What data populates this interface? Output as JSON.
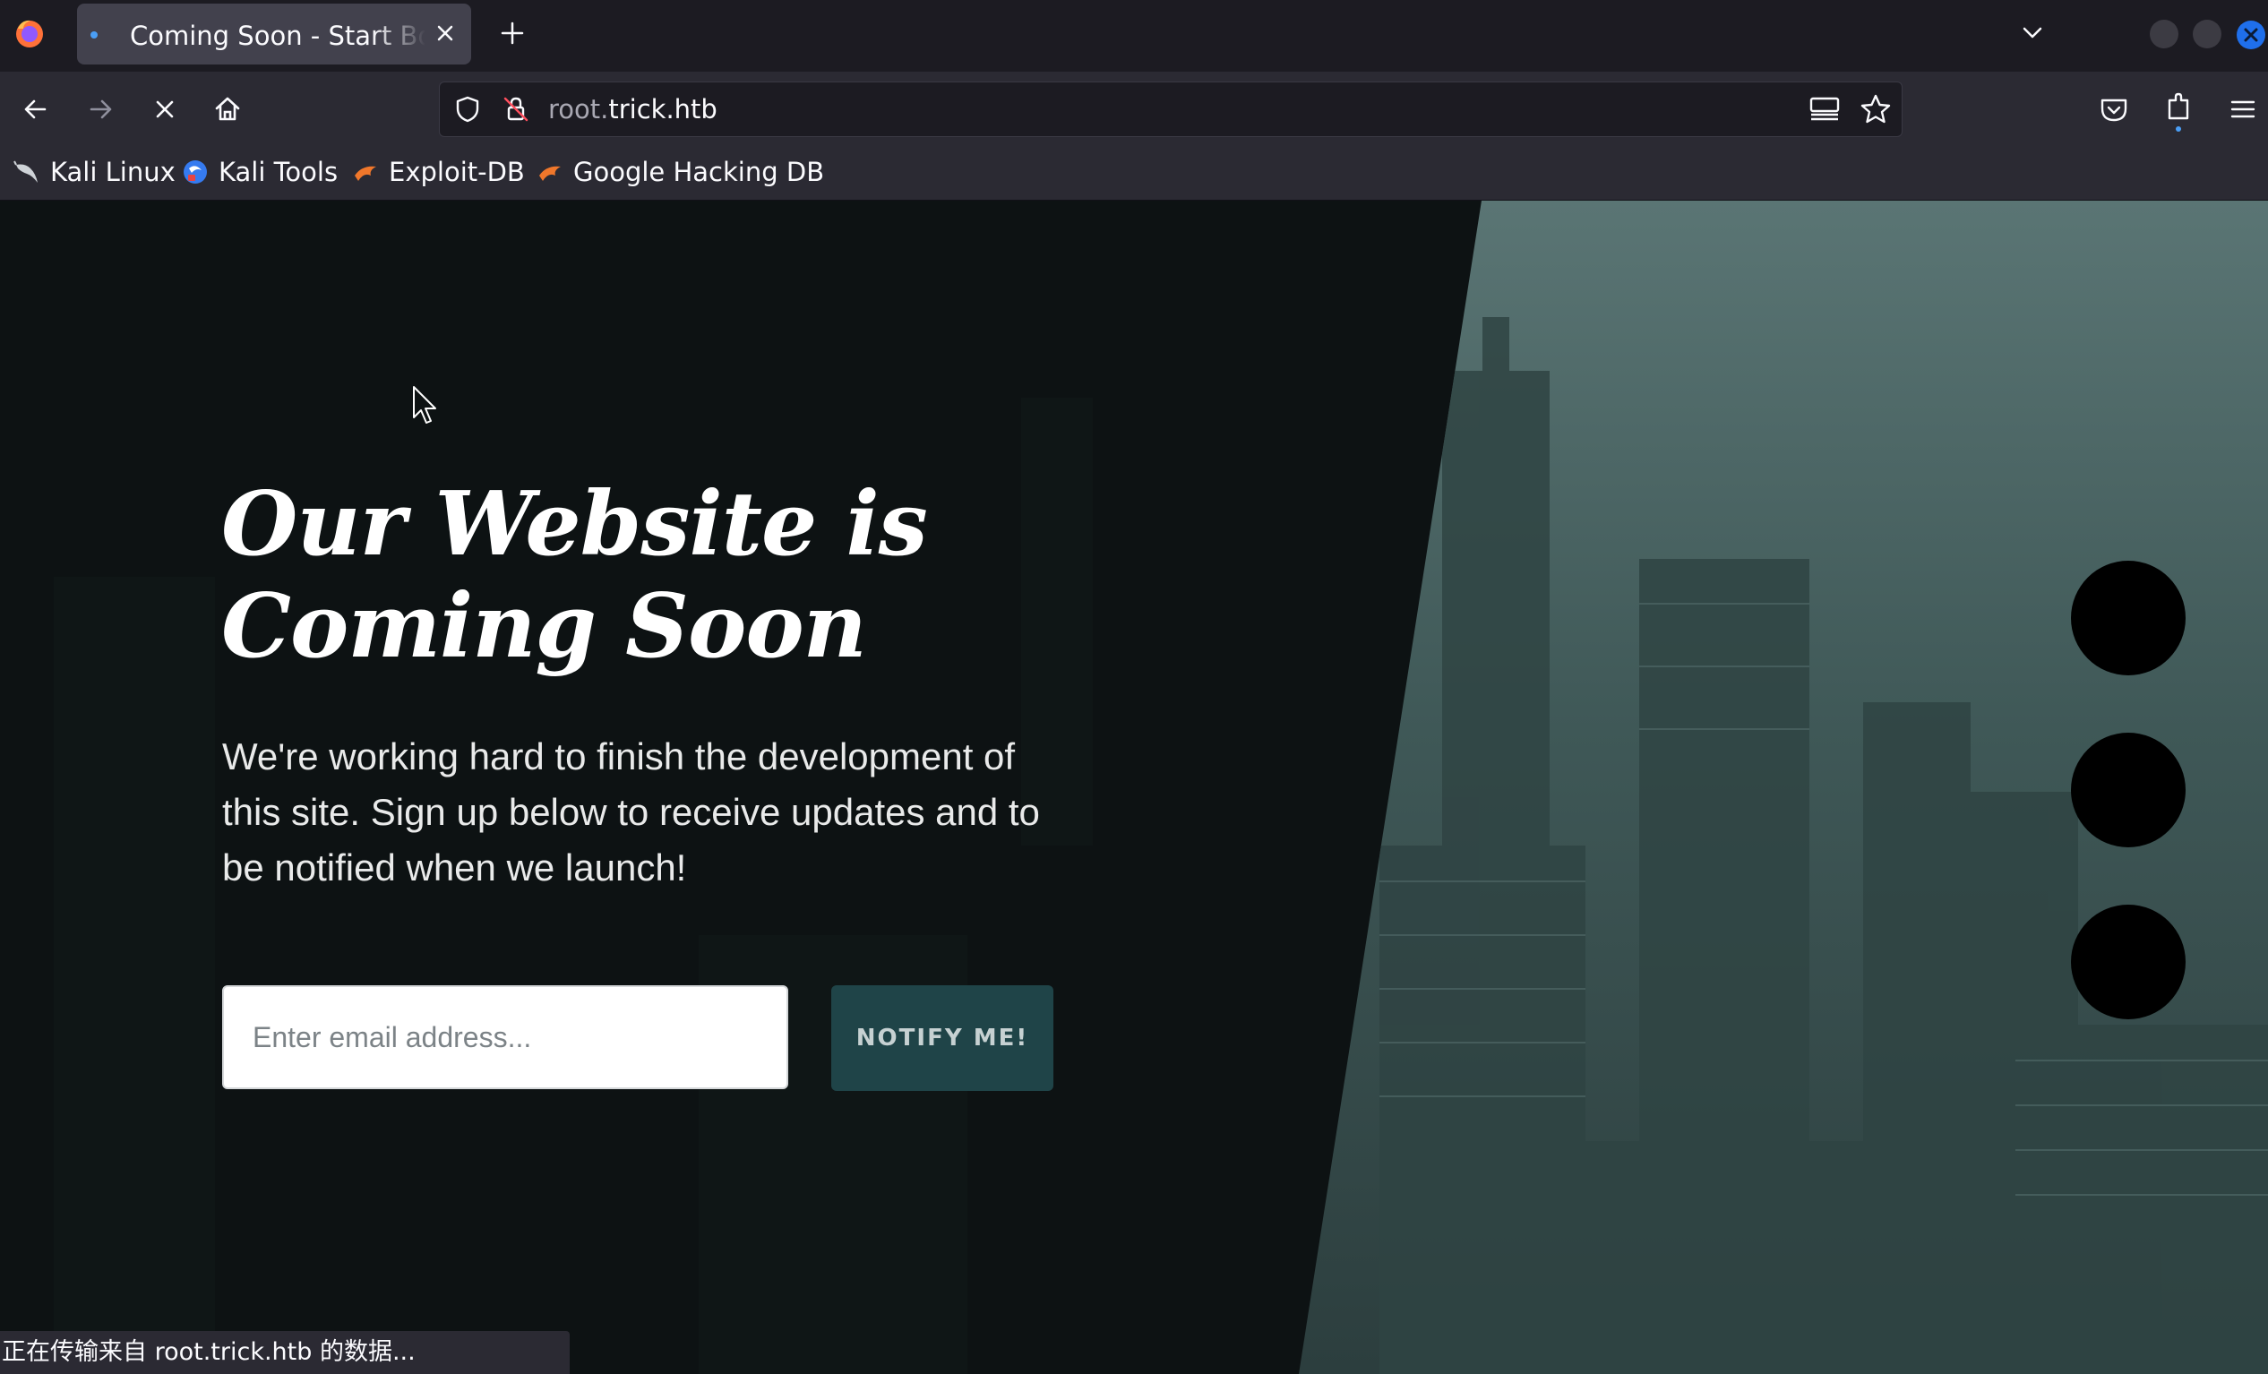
{
  "browser": {
    "tab": {
      "title": "Coming Soon - Start Bootstrap Theme"
    },
    "address_bar": {
      "url_prefix": "root.",
      "url_domain": "trick.htb"
    },
    "bookmarks": [
      {
        "label": "Kali Linux",
        "icon": "kali-dragon-icon"
      },
      {
        "label": "Kali Tools",
        "icon": "kali-tools-icon"
      },
      {
        "label": "Exploit-DB",
        "icon": "exploit-db-icon"
      },
      {
        "label": "Google Hacking DB",
        "icon": "ghdb-icon"
      }
    ],
    "status_text": "正在传输来自 root.trick.htb 的数据..."
  },
  "page": {
    "headline_line1": "Our Website is",
    "headline_line2": "Coming Soon",
    "description": "We're working hard to finish the development of this site. Sign up below to receive updates and to be notified when we launch!",
    "email_placeholder": "Enter email address...",
    "notify_button": "NOTIFY ME!",
    "social_buttons": [
      "social-button-1",
      "social-button-2",
      "social-button-3"
    ]
  },
  "colors": {
    "chrome_dark": "#1c1b22",
    "chrome": "#2b2a33",
    "page_left": "#0d1213",
    "page_right": "#3d5756",
    "button": "#1f4448"
  }
}
